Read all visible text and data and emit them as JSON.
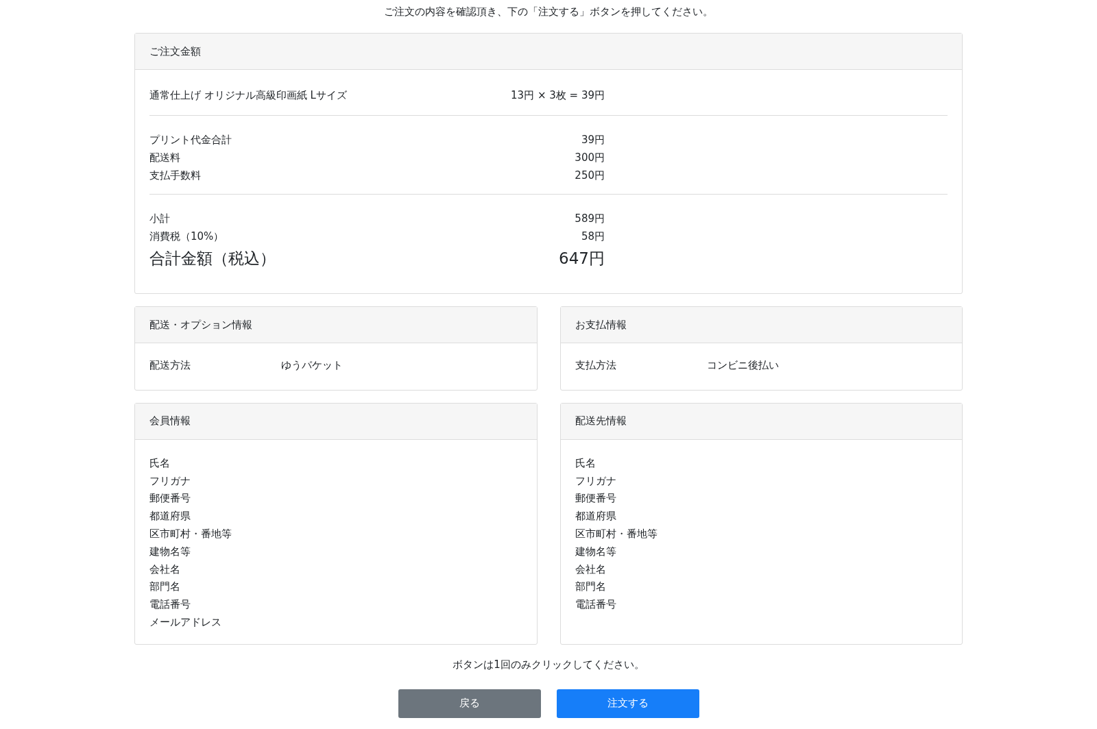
{
  "instruction": "ご注文の内容を確認頂き、下の「注文する」ボタンを押してください。",
  "order_amount": {
    "title": "ご注文金額",
    "items": [
      {
        "label": "通常仕上げ オリジナル高級印画紙 Lサイズ",
        "value": "13円 × 3枚 = 39円"
      }
    ],
    "charges": [
      {
        "label": "プリント代金合計",
        "value": "39円"
      },
      {
        "label": "配送料",
        "value": "300円"
      },
      {
        "label": "支払手数料",
        "value": "250円"
      }
    ],
    "subtotals": [
      {
        "label": "小計",
        "value": "589円"
      },
      {
        "label": "消費税（10%）",
        "value": "58円"
      }
    ],
    "total": {
      "label": "合計金額（税込）",
      "value": "647円"
    }
  },
  "panels": [
    {
      "title": "配送・オプション情報",
      "rows": [
        {
          "label": "配送方法",
          "value": "ゆうパケット"
        }
      ]
    },
    {
      "title": "お支払情報",
      "rows": [
        {
          "label": "支払方法",
          "value": "コンビニ後払い"
        }
      ]
    },
    {
      "title": "会員情報",
      "rows": [
        {
          "label": "氏名"
        },
        {
          "label": "フリガナ"
        },
        {
          "label": "郵便番号"
        },
        {
          "label": "都道府県"
        },
        {
          "label": "区市町村・番地等"
        },
        {
          "label": "建物名等"
        },
        {
          "label": "会社名"
        },
        {
          "label": "部門名"
        },
        {
          "label": "電話番号"
        },
        {
          "label": "メールアドレス"
        }
      ]
    },
    {
      "title": "配送先情報",
      "rows": [
        {
          "label": "氏名"
        },
        {
          "label": "フリガナ"
        },
        {
          "label": "郵便番号"
        },
        {
          "label": "都道府県"
        },
        {
          "label": "区市町村・番地等"
        },
        {
          "label": "建物名等"
        },
        {
          "label": "会社名"
        },
        {
          "label": "部門名"
        },
        {
          "label": "電話番号"
        }
      ]
    }
  ],
  "note": "ボタンは1回のみクリックしてください。",
  "buttons": [
    {
      "label": "戻る",
      "kind": "secondary"
    },
    {
      "label": "注文する",
      "kind": "primary"
    }
  ]
}
